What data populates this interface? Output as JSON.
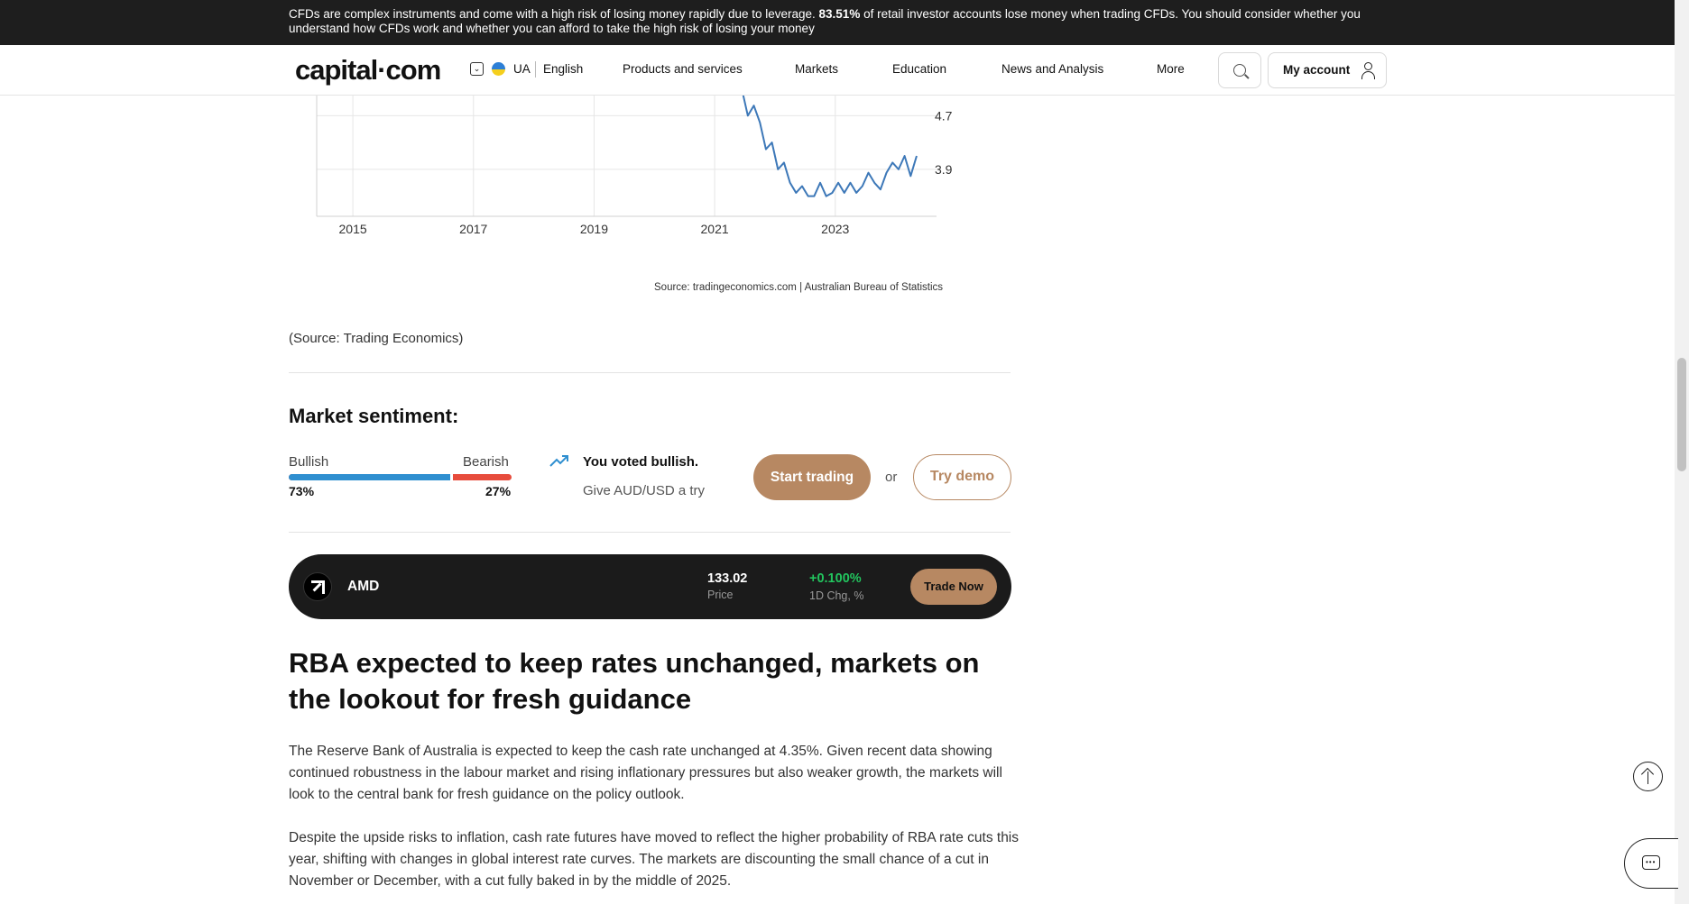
{
  "risk_banner": {
    "text_before": "CFDs are complex instruments and come with a high risk of losing money rapidly due to leverage. ",
    "highlight": "83.51%",
    "text_after": " of retail investor accounts lose money when trading CFDs. You should consider whether you understand how CFDs work and whether you can afford to take the high risk of losing your money"
  },
  "header": {
    "logo": "capital·com",
    "region": "UA",
    "language": "English",
    "nav": [
      "Products and services",
      "Markets",
      "Education",
      "News and Analysis",
      "More"
    ],
    "account_label": "My account"
  },
  "chart_data": {
    "type": "line",
    "title": "",
    "xlabel": "",
    "ylabel": "",
    "x_ticks": [
      "2015",
      "2017",
      "2019",
      "2021",
      "2023"
    ],
    "y_ticks": [
      3.9,
      4.7
    ],
    "xlim": [
      2014.4,
      2024.5
    ],
    "ylim": [
      3.2,
      5.0
    ],
    "series": [
      {
        "color": "#3d78b8",
        "x": [
          2021.45,
          2021.55,
          2021.65,
          2021.75,
          2021.85,
          2021.95,
          2022.05,
          2022.15,
          2022.25,
          2022.35,
          2022.45,
          2022.55,
          2022.65,
          2022.75,
          2022.85,
          2022.95,
          2023.05,
          2023.15,
          2023.25,
          2023.35,
          2023.45,
          2023.55,
          2023.65,
          2023.75,
          2023.85,
          2023.95,
          2024.05,
          2024.15,
          2024.25,
          2024.35
        ],
        "y": [
          5.1,
          4.7,
          4.85,
          4.6,
          4.2,
          4.3,
          3.9,
          4.0,
          3.7,
          3.55,
          3.65,
          3.5,
          3.5,
          3.7,
          3.5,
          3.55,
          3.7,
          3.55,
          3.7,
          3.55,
          3.65,
          3.85,
          3.7,
          3.6,
          3.85,
          4.0,
          3.9,
          4.1,
          3.8,
          4.1
        ]
      }
    ],
    "source": "Source: tradingeconomics.com | Australian Bureau of Statistics"
  },
  "article_source": "(Source: Trading Economics)",
  "sentiment": {
    "title": "Market sentiment:",
    "bullish_label": "Bullish",
    "bearish_label": "Bearish",
    "bullish_pct_text": "73%",
    "bearish_pct_text": "27%",
    "bullish_fraction": 0.73,
    "voted_text": "You voted bullish.",
    "give_text": "Give AUD/USD a try",
    "start_label": "Start trading",
    "or_text": "or",
    "demo_label": "Try demo"
  },
  "instrument": {
    "name": "AMD",
    "price": "133.02",
    "price_label": "Price",
    "change": "+0.100%",
    "change_label": "1D Chg, %",
    "trade_label": "Trade Now"
  },
  "article": {
    "headline": "RBA expected to keep rates unchanged, markets on the lookout for fresh guidance",
    "paragraphs": [
      "The Reserve Bank of Australia is expected to keep the cash rate unchanged at 4.35%. Given recent data showing continued robustness in the labour market and rising inflationary pressures but also weaker growth, the markets will look to the central bank for fresh guidance on the policy outlook.",
      "Despite the upside risks to inflation, cash rate futures have moved to reflect the higher probability of RBA rate cuts this year, shifting with changes in global interest rate curves. The markets are discounting the small chance of a cut in November or December, with a cut fully baked in by the middle of 2025."
    ]
  },
  "colors": {
    "accent": "#b78862",
    "bullish": "#2f8fd0",
    "bearish": "#e74c3c",
    "positive": "#22c55e"
  }
}
